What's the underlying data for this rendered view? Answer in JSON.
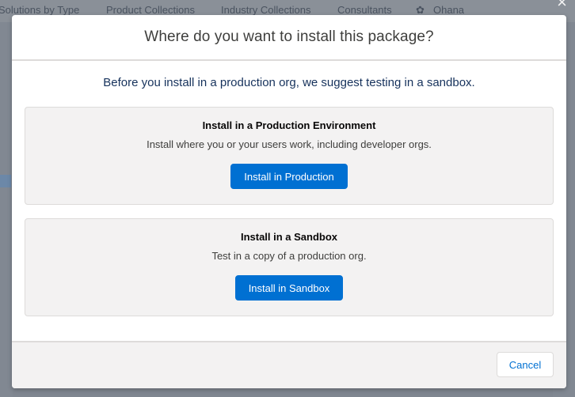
{
  "background": {
    "nav_items": [
      "Solutions by Type",
      "Product Collections",
      "Industry Collections",
      "Consultants",
      "Ohana"
    ],
    "close_glyph": "×"
  },
  "modal": {
    "title": "Where do you want to install this package?",
    "intro": "Before you install in a production org, we suggest testing in a sandbox.",
    "production": {
      "title": "Install in a Production Environment",
      "description": "Install where you or your users work, including developer orgs.",
      "button_label": "Install in Production"
    },
    "sandbox": {
      "title": "Install in a Sandbox",
      "description": "Test in a copy of a production org.",
      "button_label": "Install in Sandbox"
    },
    "cancel_label": "Cancel"
  },
  "colors": {
    "brand": "#0070d2",
    "overlay": "#7f8690",
    "card_bg": "#f3f2f2"
  }
}
